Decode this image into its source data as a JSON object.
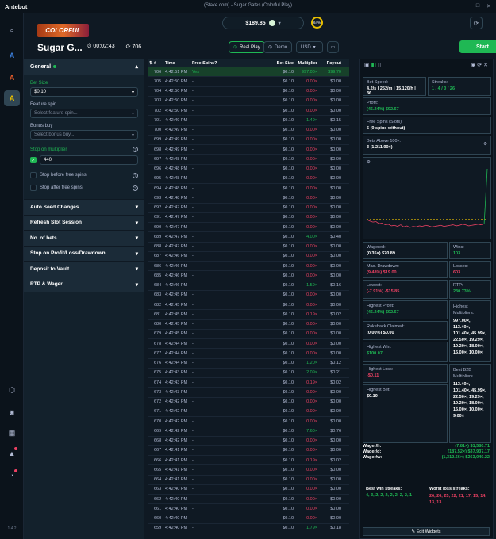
{
  "window": {
    "title": "(Stake.com) - Sugar Gates (Colorful Play)",
    "logo": "Antebot",
    "version": "1.4.2"
  },
  "header": {
    "provider_badge": "COLORFUL",
    "game_title": "Sugar G...",
    "timer": "00:02:43",
    "spin_count": "706",
    "balance": "$189.85",
    "pct": "64%",
    "real_play": "Real Play",
    "demo": "Demo",
    "currency": "USD",
    "start": "Start"
  },
  "left": {
    "general": "General",
    "bet_size_label": "Bet Size",
    "bet_size": "$0.10",
    "feature_spin_label": "Feature spin",
    "feature_spin_ph": "Select feature spin...",
    "bonus_buy_label": "Bonus buy",
    "bonus_buy_ph": "Select bonus buy...",
    "stop_multi_label": "Stop on multiplier",
    "stop_multi_val": "440",
    "stop_before": "Stop before free spins",
    "stop_after": "Stop after free spins",
    "sections": [
      "Auto Seed Changes",
      "Refresh Slot Session",
      "No. of bets",
      "Stop on Profit/Loss/Drawdown",
      "Deposit to Vault",
      "RTP & Wager"
    ]
  },
  "table": {
    "headers": [
      "#",
      "Time",
      "Free Spins?",
      "Bet Size",
      "Multiplier",
      "Payout"
    ],
    "rows": [
      [
        "706",
        "4:42:51 PM",
        "Yes",
        "$0.10",
        "997.00×",
        "$99.70"
      ],
      [
        "705",
        "4:42:50 PM",
        "-",
        "$0.10",
        "0.00×",
        "$0.00"
      ],
      [
        "704",
        "4:42:50 PM",
        "-",
        "$0.10",
        "0.00×",
        "$0.00"
      ],
      [
        "703",
        "4:42:50 PM",
        "-",
        "$0.10",
        "0.00×",
        "$0.00"
      ],
      [
        "702",
        "4:42:50 PM",
        "-",
        "$0.10",
        "0.00×",
        "$0.00"
      ],
      [
        "701",
        "4:42:49 PM",
        "-",
        "$0.10",
        "1.49×",
        "$0.15"
      ],
      [
        "700",
        "4:42:49 PM",
        "-",
        "$0.10",
        "0.00×",
        "$0.00"
      ],
      [
        "699",
        "4:42:49 PM",
        "-",
        "$0.10",
        "0.00×",
        "$0.00"
      ],
      [
        "698",
        "4:42:49 PM",
        "-",
        "$0.10",
        "0.00×",
        "$0.00"
      ],
      [
        "697",
        "4:42:48 PM",
        "-",
        "$0.10",
        "0.00×",
        "$0.00"
      ],
      [
        "696",
        "4:42:48 PM",
        "-",
        "$0.10",
        "0.00×",
        "$0.00"
      ],
      [
        "695",
        "4:42:48 PM",
        "-",
        "$0.10",
        "0.00×",
        "$0.00"
      ],
      [
        "694",
        "4:42:48 PM",
        "-",
        "$0.10",
        "0.00×",
        "$0.00"
      ],
      [
        "693",
        "4:42:48 PM",
        "-",
        "$0.10",
        "0.00×",
        "$0.00"
      ],
      [
        "692",
        "4:42:47 PM",
        "-",
        "$0.10",
        "0.00×",
        "$0.00"
      ],
      [
        "691",
        "4:42:47 PM",
        "-",
        "$0.10",
        "0.00×",
        "$0.00"
      ],
      [
        "690",
        "4:42:47 PM",
        "-",
        "$0.10",
        "0.00×",
        "$0.00"
      ],
      [
        "689",
        "4:42:47 PM",
        "-",
        "$0.10",
        "4.00×",
        "$0.40"
      ],
      [
        "688",
        "4:42:47 PM",
        "-",
        "$0.10",
        "0.00×",
        "$0.00"
      ],
      [
        "687",
        "4:42:46 PM",
        "-",
        "$0.10",
        "0.00×",
        "$0.00"
      ],
      [
        "686",
        "4:42:46 PM",
        "-",
        "$0.10",
        "0.00×",
        "$0.00"
      ],
      [
        "685",
        "4:42:46 PM",
        "-",
        "$0.10",
        "0.00×",
        "$0.00"
      ],
      [
        "684",
        "4:42:46 PM",
        "-",
        "$0.10",
        "1.59×",
        "$0.16"
      ],
      [
        "683",
        "4:42:45 PM",
        "-",
        "$0.10",
        "0.00×",
        "$0.00"
      ],
      [
        "682",
        "4:42:45 PM",
        "-",
        "$0.10",
        "0.00×",
        "$0.00"
      ],
      [
        "681",
        "4:42:45 PM",
        "-",
        "$0.10",
        "0.19×",
        "$0.02"
      ],
      [
        "680",
        "4:42:45 PM",
        "-",
        "$0.10",
        "0.00×",
        "$0.00"
      ],
      [
        "679",
        "4:42:45 PM",
        "-",
        "$0.10",
        "0.00×",
        "$0.00"
      ],
      [
        "678",
        "4:42:44 PM",
        "-",
        "$0.10",
        "0.00×",
        "$0.00"
      ],
      [
        "677",
        "4:42:44 PM",
        "-",
        "$0.10",
        "0.00×",
        "$0.00"
      ],
      [
        "676",
        "4:42:44 PM",
        "-",
        "$0.10",
        "1.20×",
        "$0.12"
      ],
      [
        "675",
        "4:42:43 PM",
        "-",
        "$0.10",
        "2.09×",
        "$0.21"
      ],
      [
        "674",
        "4:42:43 PM",
        "-",
        "$0.10",
        "0.19×",
        "$0.02"
      ],
      [
        "673",
        "4:42:43 PM",
        "-",
        "$0.10",
        "0.00×",
        "$0.00"
      ],
      [
        "672",
        "4:42:42 PM",
        "-",
        "$0.10",
        "0.00×",
        "$0.00"
      ],
      [
        "671",
        "4:42:42 PM",
        "-",
        "$0.10",
        "0.00×",
        "$0.00"
      ],
      [
        "670",
        "4:42:42 PM",
        "-",
        "$0.10",
        "0.00×",
        "$0.00"
      ],
      [
        "669",
        "4:42:42 PM",
        "-",
        "$0.10",
        "7.60×",
        "$0.76"
      ],
      [
        "668",
        "4:42:42 PM",
        "-",
        "$0.10",
        "0.00×",
        "$0.00"
      ],
      [
        "667",
        "4:42:41 PM",
        "-",
        "$0.10",
        "0.00×",
        "$0.00"
      ],
      [
        "666",
        "4:42:41 PM",
        "-",
        "$0.10",
        "0.19×",
        "$0.02"
      ],
      [
        "665",
        "4:42:41 PM",
        "-",
        "$0.10",
        "0.00×",
        "$0.00"
      ],
      [
        "664",
        "4:42:41 PM",
        "-",
        "$0.10",
        "0.00×",
        "$0.00"
      ],
      [
        "663",
        "4:42:40 PM",
        "-",
        "$0.10",
        "0.00×",
        "$0.00"
      ],
      [
        "662",
        "4:42:40 PM",
        "-",
        "$0.10",
        "0.00×",
        "$0.00"
      ],
      [
        "661",
        "4:42:40 PM",
        "-",
        "$0.10",
        "0.00×",
        "$0.00"
      ],
      [
        "660",
        "4:42:40 PM",
        "-",
        "$0.10",
        "0.00×",
        "$0.00"
      ],
      [
        "659",
        "4:42:40 PM",
        "-",
        "$0.10",
        "1.79×",
        "$0.18"
      ]
    ]
  },
  "stats": {
    "bet_speed_label": "Bet Speed:",
    "bet_speed": "4.2/s | 252/m | 15,120/h | 36...",
    "streaks_label": "Streaks:",
    "streaks": "1 / 4 / 0 / 26",
    "profit_label": "Profit:",
    "profit": "(46.24%) $92.67",
    "free_spins_label": "Free Spins (Slots):",
    "free_spins": "5 (0 spins without)",
    "bets_above_label": "Bets Above 100×:",
    "bets_above": "3 (1,211.90×)",
    "wagered_label": "Wagered:",
    "wagered": "(0.35×) $70.89",
    "wins_label": "Wins:",
    "wins": "103",
    "maxdd_label": "Max. Drawdown:",
    "maxdd": "(9.48%) $19.00",
    "losses_label": "Losses:",
    "losses": "603",
    "lowest_label": "Lowest:",
    "lowest": "(-7.91%) -$15.85",
    "rtp_label": "RTP:",
    "rtp": "230.73%",
    "hprofit_label": "Highest Profit:",
    "hprofit": "(46.24%) $92.67",
    "hmulti_label": "Highest Multipliers:",
    "hmulti": "997.00×, 113.49×, 101.40×, 45.99×, 22.50×, 19.29×, 19.20×, 18.00×, 15.00×, 10.00×",
    "rake_label": "Rakeback Claimed:",
    "rake": "(0.00%) $0.00",
    "hwin_label": "Highest Win:",
    "hwin": "$100.07",
    "b2b_label": "Best B2B Multipliers",
    "b2b": "113.49×, 101.40×, 45.99×, 22.50×, 19.29×, 19.20×, 18.00×, 15.00×, 10.00×, 9.00×",
    "hloss_label": "Highest Loss:",
    "hloss": "-$0.11",
    "hbet_label": "Highest Bet:",
    "hbet": "$0.10",
    "wh_label": "Wager/h:",
    "wh": "(7.81×) $1,580.71",
    "wd_label": "Wager/d:",
    "wd": "(187.52×) $37,937.17",
    "ww_label": "Wager/w:",
    "ww": "(1,312.66×) $263,040.22",
    "bws_label": "Best win streaks:",
    "bws": "4, 3, 2, 2, 2, 2, 2, 2, 2, 1",
    "wls_label": "Worst loss streaks:",
    "wls": "26, 26, 25, 22, 21, 17, 15, 14, 13, 13",
    "edit": "Edit Widgets"
  },
  "chart_data": {
    "type": "line",
    "series": [
      {
        "values": [
          0,
          -3,
          -5,
          -4,
          -8,
          -7,
          -10,
          -9,
          -12,
          -11,
          -13,
          -10,
          -14,
          -12,
          -15,
          -13,
          -14,
          -12,
          -13,
          -11,
          -12,
          -14,
          -13,
          -12,
          -11,
          -13,
          -12,
          -11,
          -10,
          -12,
          -11,
          -9,
          -10,
          -12,
          -11,
          -10,
          -9,
          -10,
          -8,
          93
        ]
      }
    ],
    "zero_line": true,
    "colors": {
      "up": "#1fb854",
      "down": "#ed4163"
    }
  },
  "colors": {
    "accent": "#1fb854",
    "red": "#ed4163",
    "bg": "#0f1923"
  }
}
